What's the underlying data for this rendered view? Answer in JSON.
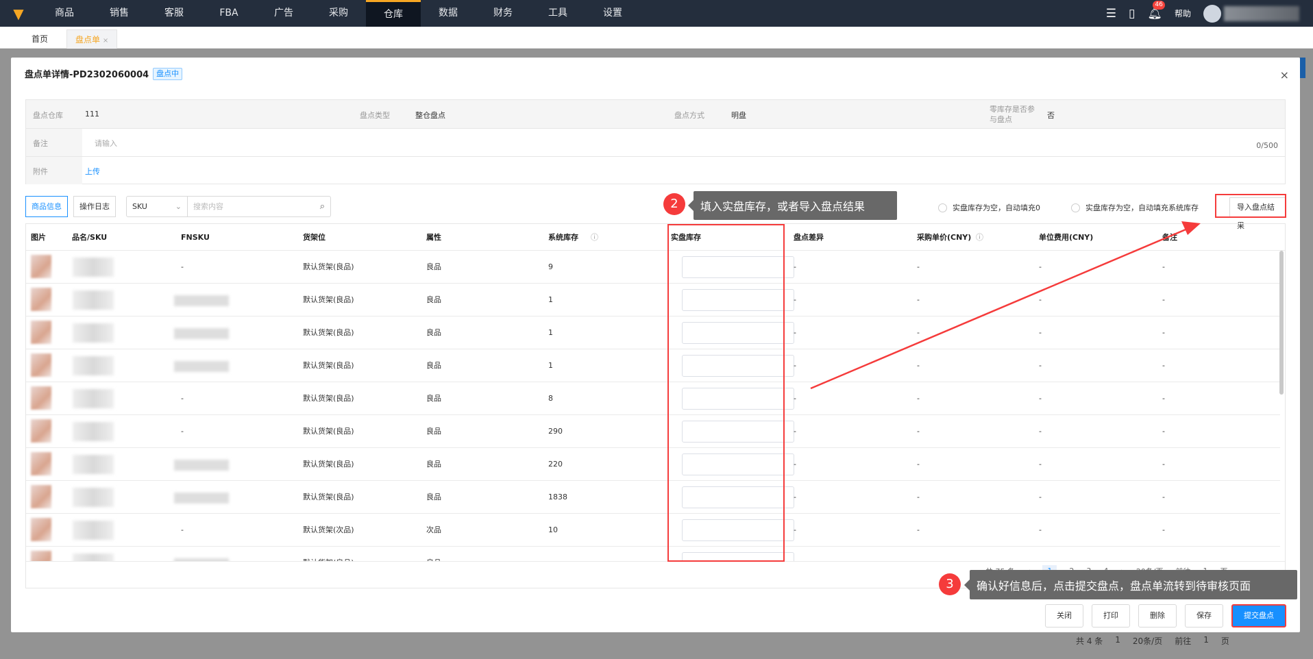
{
  "nav": {
    "logo": "fox-logo",
    "items": [
      "商品",
      "销售",
      "客服",
      "FBA",
      "广告",
      "采购",
      "仓库",
      "数据",
      "财务",
      "工具",
      "设置"
    ],
    "active": "仓库",
    "notification_count": "46",
    "help": "帮助"
  },
  "tabs": {
    "home": "首页",
    "current": "盘点单",
    "close": "×"
  },
  "modal": {
    "title": "盘点单详情-PD2302060004",
    "status": "盘点中",
    "close": "×",
    "info": {
      "warehouse_label": "盘点仓库",
      "warehouse": "111",
      "type_label": "盘点类型",
      "type": "整仓盘点",
      "method_label": "盘点方式",
      "method": "明盘",
      "zero_label": "零库存是否参与盘点",
      "zero": "否",
      "remark_label": "备注",
      "remark_placeholder": "请输入",
      "remark_count": "0/500",
      "attach_label": "附件",
      "upload": "上传"
    },
    "toolbar": {
      "tab_goods": "商品信息",
      "tab_log": "操作日志",
      "select": "SKU",
      "search_placeholder": "搜索内容",
      "radio1": "实盘库存为空，自动填充0",
      "radio2": "实盘库存为空，自动填充系统库存",
      "import": "导入盘点结果"
    },
    "columns": [
      "图片",
      "品名/SKU",
      "FNSKU",
      "货架位",
      "属性",
      "系统库存",
      "实盘库存",
      "盘点差异",
      "采购单价(CNY)",
      "单位费用(CNY)",
      "备注"
    ],
    "rows": [
      {
        "fnsku": "-",
        "shelf": "默认货架(良品)",
        "attr": "良品",
        "stock": "9",
        "diff": "-",
        "price": "-",
        "fee": "-",
        "note": "-"
      },
      {
        "fnsku": "",
        "shelf": "默认货架(良品)",
        "attr": "良品",
        "stock": "1",
        "diff": "-",
        "price": "-",
        "fee": "-",
        "note": "-"
      },
      {
        "fnsku": "",
        "shelf": "默认货架(良品)",
        "attr": "良品",
        "stock": "1",
        "diff": "-",
        "price": "-",
        "fee": "-",
        "note": "-"
      },
      {
        "fnsku": "",
        "shelf": "默认货架(良品)",
        "attr": "良品",
        "stock": "1",
        "diff": "-",
        "price": "-",
        "fee": "-",
        "note": "-"
      },
      {
        "fnsku": "-",
        "shelf": "默认货架(良品)",
        "attr": "良品",
        "stock": "8",
        "diff": "-",
        "price": "-",
        "fee": "-",
        "note": "-"
      },
      {
        "fnsku": "-",
        "shelf": "默认货架(良品)",
        "attr": "良品",
        "stock": "290",
        "diff": "-",
        "price": "-",
        "fee": "-",
        "note": "-"
      },
      {
        "fnsku": "",
        "shelf": "默认货架(良品)",
        "attr": "良品",
        "stock": "220",
        "diff": "-",
        "price": "-",
        "fee": "-",
        "note": "-"
      },
      {
        "fnsku": "",
        "shelf": "默认货架(良品)",
        "attr": "良品",
        "stock": "1838",
        "diff": "-",
        "price": "-",
        "fee": "-",
        "note": "-"
      },
      {
        "fnsku": "-",
        "shelf": "默认货架(次品)",
        "attr": "次品",
        "stock": "10",
        "diff": "-",
        "price": "-",
        "fee": "-",
        "note": "-"
      },
      {
        "fnsku": "",
        "shelf": "默认货架(良品)",
        "attr": "良品",
        "stock": "",
        "diff": "",
        "price": "",
        "fee": "",
        "note": ""
      }
    ],
    "pager": {
      "total": "共 75 条",
      "pages": [
        "1",
        "2",
        "3",
        "4"
      ],
      "page_size": "20条/页",
      "goto": "前往",
      "goto_value": "1",
      "page_unit": "页"
    },
    "buttons": {
      "close": "关闭",
      "print": "打印",
      "delete": "删除",
      "save": "保存",
      "submit": "提交盘点"
    }
  },
  "annotations": {
    "step2_num": "2",
    "step2": "填入实盘库存，或者导入盘点结果",
    "step3_num": "3",
    "step3": "确认好信息后，点击提交盘点，盘点单流转到待审核页面",
    "color": "#f53b3b"
  },
  "bg_pager": {
    "total": "共 4 条",
    "page": "1",
    "page_size": "20条/页",
    "goto": "前往",
    "goto_value": "1",
    "page_unit": "页"
  }
}
